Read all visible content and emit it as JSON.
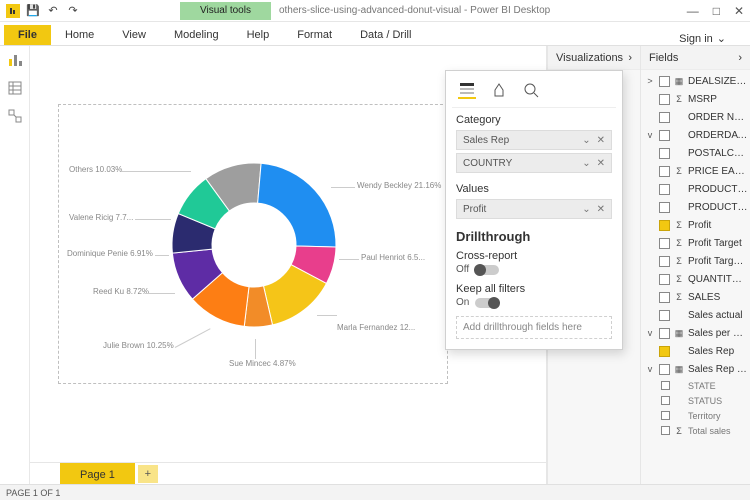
{
  "title_bar": {
    "visual_tools": "Visual tools",
    "document": "others-slice-using-advanced-donut-visual - Power BI Desktop"
  },
  "ribbon": {
    "file": "File",
    "tabs": [
      "Home",
      "View",
      "Modeling",
      "Help",
      "Format",
      "Data / Drill"
    ],
    "sign_in": "Sign in"
  },
  "panes": {
    "visualizations": "Visualizations",
    "fields": "Fields"
  },
  "fields": {
    "items": [
      {
        "exp": ">",
        "tbl": true,
        "name": "DEALSIZE Hierar..."
      },
      {
        "sigma": true,
        "name": "MSRP"
      },
      {
        "name": "ORDER NUMBER"
      },
      {
        "exp": "v",
        "name": "ORDERDATE"
      },
      {
        "name": "POSTALCODE"
      },
      {
        "sigma": true,
        "name": "PRICE EACH"
      },
      {
        "name": "PRODUCTCODE"
      },
      {
        "name": "PRODUCTLINE"
      },
      {
        "sigma": true,
        "name": "Profit",
        "checked": true
      },
      {
        "sigma": true,
        "name": "Profit Target"
      },
      {
        "sigma": true,
        "name": "Profit Target %"
      },
      {
        "sigma": true,
        "name": "QUANTITY ORDE..."
      },
      {
        "sigma": true,
        "name": "SALES"
      },
      {
        "name": "Sales actual"
      },
      {
        "exp": "v",
        "tbl": true,
        "name": "Sales per product"
      },
      {
        "name": "Sales Rep",
        "checked": true
      },
      {
        "exp": "v",
        "tbl": true,
        "name": "Sales Rep perf."
      }
    ],
    "sub": [
      "STATE",
      "STATUS",
      "Territory",
      "Total sales"
    ]
  },
  "viz": {
    "section_category": "Category",
    "well_salesrep": "Sales Rep",
    "well_country": "COUNTRY",
    "section_values": "Values",
    "well_profit": "Profit",
    "drillthrough": "Drillthrough",
    "cross_report": "Cross-report",
    "off": "Off",
    "keep_filters": "Keep all filters",
    "on": "On",
    "add_drill": "Add drillthrough fields here"
  },
  "pages": {
    "page1": "Page 1"
  },
  "status": "PAGE 1 OF 1",
  "donut": {
    "labels": {
      "others": "Others 10.03%",
      "valerie": "Valene Ricig 7.7...",
      "dominique": "Dominique Penie 6.91%",
      "reed": "Reed Ku 8.72%",
      "julie": "Julie Brown 10.25%",
      "sue": "Sue Mincec 4.87%",
      "marla": "Marla Fernandez 12...",
      "paul": "Paul Henriot 6.5...",
      "wendy": "Wendy Beckley 21.16%"
    }
  },
  "chart_data": {
    "type": "pie",
    "title": "",
    "inner_radius_ratio": 0.5,
    "series": [
      {
        "name": "Others",
        "value": 10.03,
        "color": "#9e9e9e"
      },
      {
        "name": "Wendy Beckley",
        "value": 21.16,
        "color": "#1f8ef1"
      },
      {
        "name": "Paul Henriot",
        "value": 6.5,
        "color": "#e83e8c"
      },
      {
        "name": "Marla Fernandez",
        "value": 12.0,
        "color": "#f5c518"
      },
      {
        "name": "Sue Mincec",
        "value": 4.87,
        "color": "#f28c28"
      },
      {
        "name": "Julie Brown",
        "value": 10.25,
        "color": "#fd7e14"
      },
      {
        "name": "Reed Ku",
        "value": 8.72,
        "color": "#5e2ca5"
      },
      {
        "name": "Dominique Penie",
        "value": 6.91,
        "color": "#2b2b6f"
      },
      {
        "name": "Valene Ricig",
        "value": 7.7,
        "color": "#20c997"
      }
    ],
    "legend": false
  }
}
